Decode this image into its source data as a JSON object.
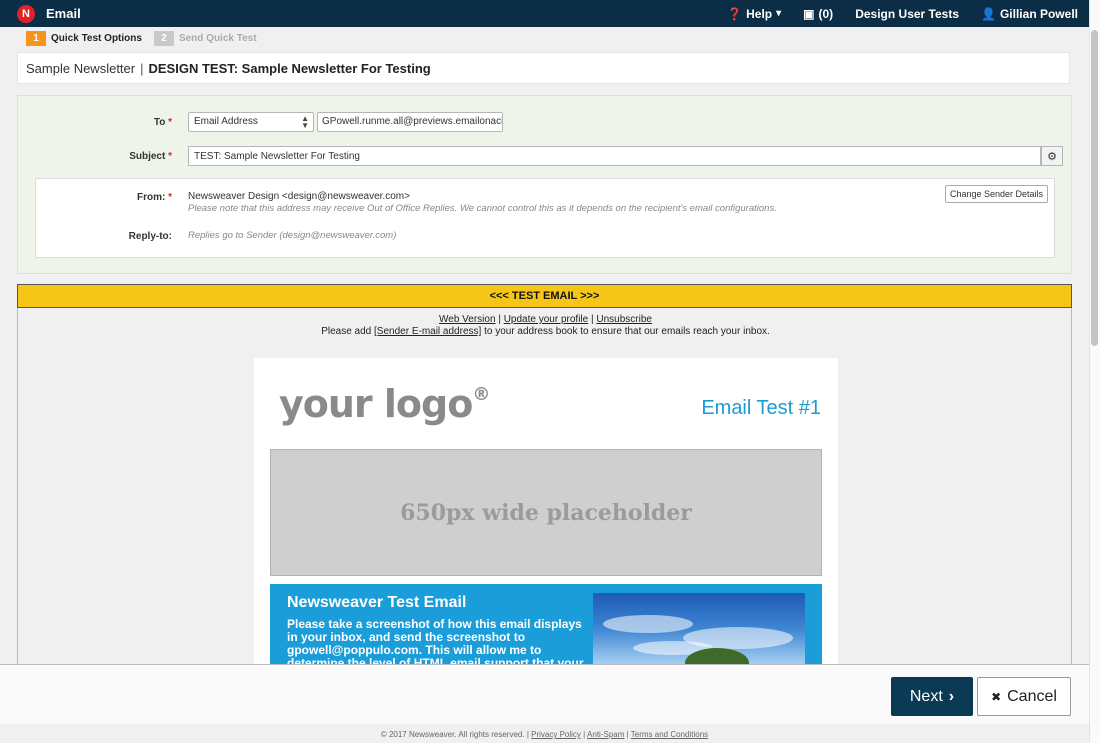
{
  "topbar": {
    "logo_letter": "N",
    "app_title": "Email",
    "help_label": "Help",
    "help_arrow": "▾",
    "notifications_count": "(0)",
    "workspace": "Design User Tests",
    "user_name": "Gillian Powell"
  },
  "steps": [
    {
      "num": "1",
      "label": "Quick Test Options"
    },
    {
      "num": "2",
      "label": "Send Quick Test"
    }
  ],
  "breadcrumb": {
    "parent": "Sample Newsletter",
    "separator": "|",
    "current": "DESIGN TEST: Sample Newsletter For Testing"
  },
  "form": {
    "to_label": "To",
    "required_mark": "*",
    "to_type_value": "Email Address",
    "to_address_value": "GPowell.runme.all@previews.emailonacid.c",
    "subject_label": "Subject",
    "subject_value": "TEST: Sample Newsletter For Testing",
    "from_label": "From:",
    "from_value": "Newsweaver Design <design@newsweaver.com>",
    "from_note": "Please note that this address may receive Out of Office Replies. We cannot control this as it depends on the recipient's email configurations.",
    "reply_label": "Reply-to:",
    "reply_value": "Replies go to Sender (design@newsweaver.com)",
    "change_sender_label": "Change Sender Details"
  },
  "preview": {
    "banner": "<<< TEST EMAIL >>>",
    "web_version": "Web Version",
    "update_profile": "Update your profile",
    "unsubscribe": "Unsubscribe",
    "link_sep": "|",
    "addr_prefix": "Please add",
    "addr_link": "[Sender E-mail address]",
    "addr_suffix": "to your address book to ensure that our emails reach your inbox.",
    "logo_text": "your logo",
    "logo_mark": "®",
    "email_heading": "Email Test #1",
    "placeholder": "650px wide placeholder",
    "section_title": "Newsweaver Test Email",
    "section_text": "Please take a screenshot of how this email displays in your inbox, and send the screenshot to gpowell@poppulo.com. This will allow me to determine the level of HTML email support that your"
  },
  "actions": {
    "next_label": "Next",
    "next_icon": "›",
    "cancel_label": "Cancel",
    "cancel_icon": "✖"
  },
  "footer": {
    "copyright": "© 2017 Newsweaver. All rights reserved.",
    "sep": "|",
    "privacy": "Privacy Policy",
    "antispam": "Anti-Spam",
    "terms": "Terms and Conditions"
  },
  "colors": {
    "topbar": "#0b2d45",
    "accent_orange": "#f7941d",
    "banner_yellow": "#f5c518",
    "email_blue": "#1a9dd9",
    "next_button": "#0b3a55"
  }
}
